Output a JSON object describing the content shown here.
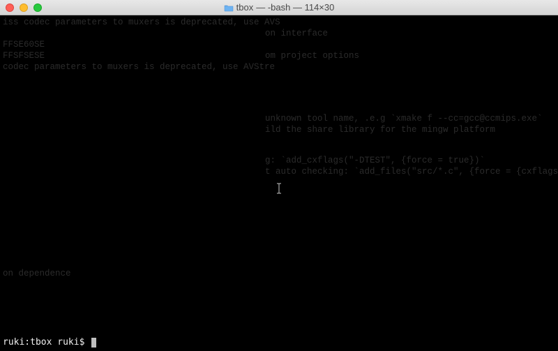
{
  "titlebar": {
    "folder_name": "tbox",
    "title_suffix": " — -bash — 114×30"
  },
  "ghost": {
    "line1": "iss codec parameters to muxers is deprecated, use AVS",
    "line2": "FFSE60SE",
    "line3": "FFSFSESE",
    "line4": "codec parameters to muxers is deprecated, use AVStre",
    "r1": "on interface",
    "r2": "om project options",
    "r3": "unknown tool name, .e.g `xmake f --cc=gcc@ccmips.exe`",
    "r4": "ild the share library for the mingw platform",
    "r5": "g: `add_cxflags(\"-DTEST\", {force = true})`",
    "r6": "t auto checking: `add_files(\"src/*.c\", {force = {cxflags = \"-",
    "dep": "on dependence"
  },
  "prompt": {
    "text": "ruki:tbox ruki$ "
  }
}
